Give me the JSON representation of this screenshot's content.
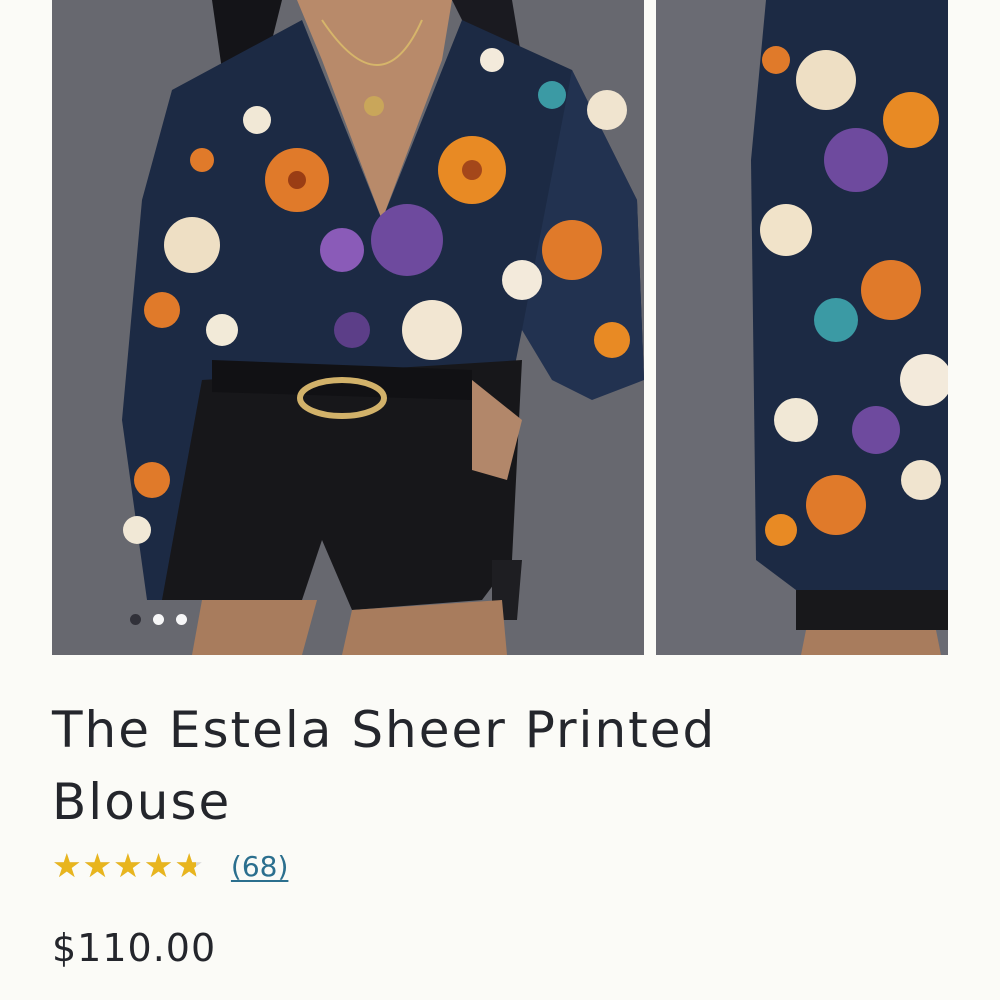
{
  "product": {
    "title": "The Estela Sheer Printed Blouse",
    "price": "$110.00",
    "rating": {
      "value": 4.7,
      "max": 5,
      "review_count_label": "(68)"
    }
  },
  "gallery": {
    "image_count": 3,
    "active_index": 1
  },
  "colors": {
    "star": "#e8b51e",
    "link": "#2b6f8e",
    "backdrop": "#6a6b73"
  }
}
